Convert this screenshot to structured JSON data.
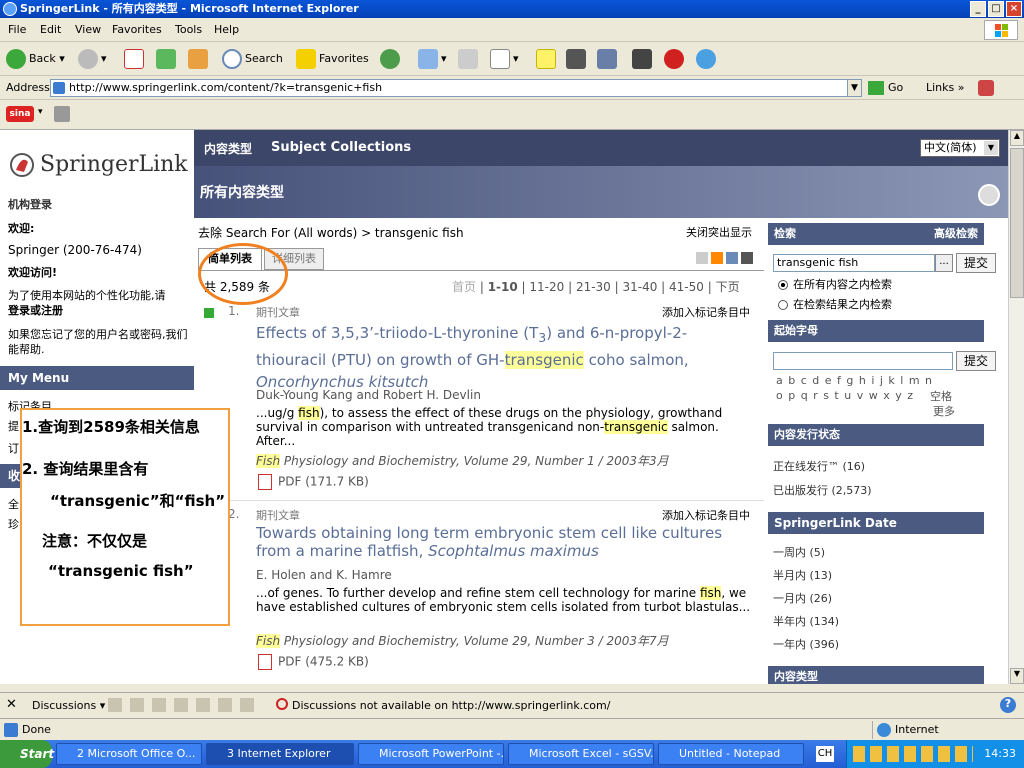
{
  "window": {
    "title": "SpringerLink - 所有内容类型 - Microsoft Internet Explorer"
  },
  "menu": [
    "File",
    "Edit",
    "View",
    "Favorites",
    "Tools",
    "Help"
  ],
  "toolbar": {
    "back": "Back",
    "search": "Search",
    "favorites": "Favorites"
  },
  "address": {
    "label": "Address",
    "url": "http://www.springerlink.com/content/?k=transgenic+fish",
    "go": "Go",
    "links": "Links"
  },
  "sidebar": {
    "logo": "SpringerLink",
    "inst_login": "机构登录",
    "welcome": "欢迎:",
    "account": "Springer (200-76-474)",
    "welcome_visit": "欢迎访问!",
    "personal_text": "为了使用本网站的个性化功能,请",
    "login_register": "登录或注册",
    "forgot_text": "如果您忘记了您的用户名或密码,我们能帮助.",
    "my_menu": "My Menu",
    "menu_items": [
      "标记条目",
      "提",
      "订"
    ],
    "fav_head": "收",
    "fav_items": [
      "全",
      "珍"
    ]
  },
  "header": {
    "tab_content": "内容类型",
    "tab_subject": "Subject Collections",
    "language": "中文(简体)",
    "section_title": "所有内容类型"
  },
  "results": {
    "breadcrumb_remove": "去除",
    "breadcrumb": "Search For (All words) > transgenic fish",
    "close_highlight": "关闭突出显示",
    "tab_simple": "简单列表",
    "tab_detail": "详细列表",
    "count": "共 2,589 条",
    "pages": [
      "首页",
      "1-10",
      "11-20",
      "21-30",
      "31-40",
      "41-50",
      "下页"
    ],
    "items": [
      {
        "num": "1.",
        "type": "期刊文章",
        "add": "添加入标记条目中",
        "title_a": "Effects of 3,5,3’-triiodo-L-thyronine (T",
        "title_sub": "3",
        "title_b": ") and 6-n-propyl-2-thiouracil (PTU) on growth of GH-",
        "title_hl": "transgenic",
        "title_c": " coho salmon, ",
        "title_i": "Oncorhynchus kitsutch",
        "authors": [
          "Duk-Young Kang",
          "Robert H. Devlin"
        ],
        "and": "and",
        "snip_a": "...ug/g ",
        "snip_hl1": "fish",
        "snip_b": "), to assess the effect of these drugs on the physiology, growthand survival in comparison with untreated transgenicand non-",
        "snip_hl2": "transgenic",
        "snip_c": " salmon. After...",
        "journal_hl": "Fish",
        "journal": " Physiology and Biochemistry, Volume 29, Number 1 / 2003年3月",
        "pdf": "PDF (171.7 KB)"
      },
      {
        "num": "2.",
        "type": "期刊文章",
        "add": "添加入标记条目中",
        "title_a": "Towards obtaining long term embryonic stem cell like cultures from a marine flatfish, ",
        "title_i": "Scophtalmus maximus",
        "authors": [
          "E. Holen",
          "K. Hamre"
        ],
        "and": "and",
        "snip_a": "...of genes. To further develop and refine stem cell technology for marine ",
        "snip_hl1": "fish",
        "snip_b": ", we have established cultures of embryonic stem cells isolated from turbot blastulas...",
        "journal_hl": "Fish",
        "journal": " Physiology and Biochemistry, Volume 29, Number 3 / 2003年7月",
        "pdf": "PDF (475.2 KB)"
      }
    ]
  },
  "right": {
    "search_head": "检索",
    "advanced": "高级检索",
    "search_value": "transgenic fish",
    "more_btn": "...",
    "submit": "提交",
    "radio_all": "在所有内容之内检索",
    "radio_results": "在检索结果之内检索",
    "letter_head": "起始字母",
    "letters_1": "a b c d e f g h i j k l m n",
    "letters_2": "o p q r s t u v w x y z",
    "space": "空格",
    "more": "更多",
    "pub_head": "内容发行状态",
    "online": "正在线发行™ (16)",
    "published": "已出版发行 (2,573)",
    "date_head": "SpringerLink Date",
    "dates": [
      "一周内 (5)",
      "半月内 (13)",
      "一月内 (26)",
      "半年内 (134)",
      "一年内 (396)"
    ],
    "type_head": "内容类型"
  },
  "callout": {
    "line1": "1.查询到2589条相关信息",
    "line2": "2. 查询结果里含有",
    "line3": "“transgenic”和“fish”",
    "line4": "注意：不仅仅是",
    "line5": "“transgenic fish”"
  },
  "discussions": {
    "label": "Discussions",
    "msg": "Discussions not available on http://www.springerlink.com/"
  },
  "status": {
    "done": "Done",
    "zone": "Internet"
  },
  "taskbar": {
    "start": "Start",
    "tasks": [
      "2 Microsoft Office O...",
      "3 Internet Explorer",
      "Microsoft PowerPoint -...",
      "Microsoft Excel - sGSV...",
      "Untitled - Notepad"
    ],
    "lang": "CH",
    "time": "14:33"
  }
}
